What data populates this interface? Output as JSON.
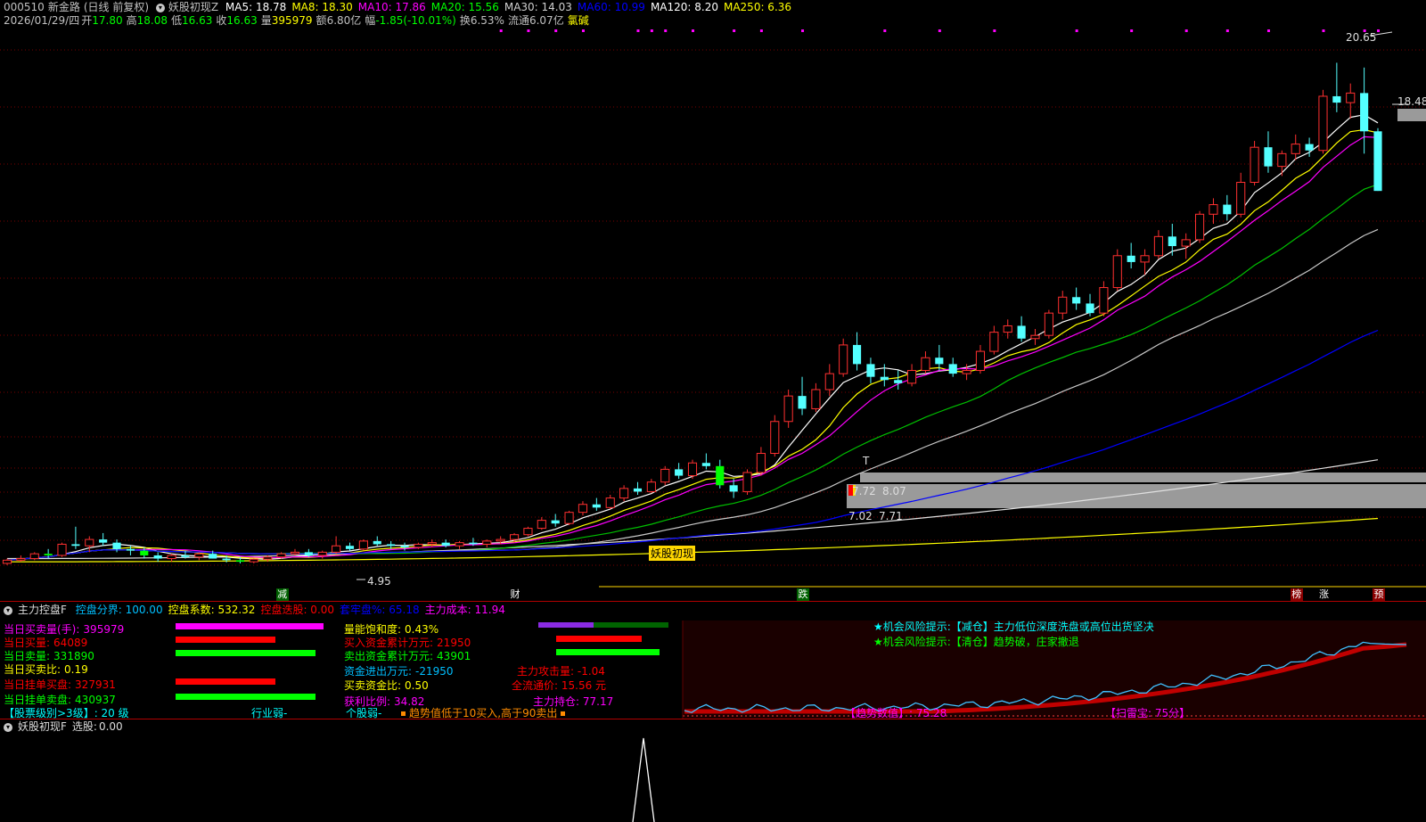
{
  "header": {
    "code": "000510",
    "name": "新金路",
    "period": "(日线 前复权)",
    "indicator": "妖股初现Z",
    "ma": [
      {
        "label": "MA5:",
        "value": "18.78",
        "color": "#ffffff"
      },
      {
        "label": "MA8:",
        "value": "18.30",
        "color": "#ffff00"
      },
      {
        "label": "MA10:",
        "value": "17.86",
        "color": "#ff00ff"
      },
      {
        "label": "MA20:",
        "value": "15.56",
        "color": "#00ff00"
      },
      {
        "label": "MA30:",
        "value": "14.03",
        "color": "#d0d0d0"
      },
      {
        "label": "MA60:",
        "value": "10.99",
        "color": "#0000ff"
      },
      {
        "label": "MA120:",
        "value": "8.20",
        "color": "#ffffff"
      },
      {
        "label": "MA250:",
        "value": "6.36",
        "color": "#ffff00"
      }
    ]
  },
  "quote": {
    "date": "2026/01/29/四",
    "open_label": "开",
    "open": "17.80",
    "high_label": "高",
    "high": "18.08",
    "low_label": "低",
    "low": "16.63",
    "close_label": "收",
    "close": "16.63",
    "vol_label": "量",
    "vol": "395979",
    "amt_label": "额",
    "amt": "6.80亿",
    "chg_label": "幅",
    "chg": "-1.85(-10.01%)",
    "turn_label": "换",
    "turn": "6.53%",
    "float_label": "流通",
    "float": "6.07亿",
    "sector": "氯碱"
  },
  "chart_data": {
    "type": "candlestick",
    "title": "",
    "price_labels": {
      "high": "20.65",
      "right": "18.48",
      "low": "4.95",
      "support_low": "7.02",
      "support_mid": "7.71",
      "zone_low": "7.72",
      "zone_high": "8.07",
      "mark_t": "T"
    },
    "signal_label": "妖股初现",
    "events": [
      {
        "label": "减",
        "color": "#ffffff",
        "bg": "#006000",
        "idx": 20
      },
      {
        "label": "财",
        "color": "#ffffff",
        "bg": "#000000",
        "idx": 37
      },
      {
        "label": "跌",
        "color": "#ffffff",
        "bg": "#006000",
        "idx": 58
      },
      {
        "label": "榜",
        "color": "#ffffff",
        "bg": "#8b0000",
        "idx": 94
      },
      {
        "label": "涨",
        "color": "#ffffff",
        "bg": "#000000",
        "idx": 96
      },
      {
        "label": "预",
        "color": "#ffffff",
        "bg": "#8b0000",
        "idx": 100
      }
    ],
    "ohlc": [
      [
        4.95,
        5.1,
        4.9,
        5.05
      ],
      [
        5.05,
        5.2,
        5.0,
        5.1
      ],
      [
        5.1,
        5.3,
        5.05,
        5.25
      ],
      [
        5.25,
        5.4,
        5.1,
        5.2
      ],
      [
        5.2,
        5.6,
        5.15,
        5.55
      ],
      [
        5.55,
        6.1,
        5.4,
        5.5
      ],
      [
        5.5,
        5.8,
        5.3,
        5.7
      ],
      [
        5.7,
        5.9,
        5.5,
        5.6
      ],
      [
        5.6,
        5.7,
        5.3,
        5.4
      ],
      [
        5.4,
        5.5,
        5.2,
        5.35
      ],
      [
        5.35,
        5.45,
        5.1,
        5.2
      ],
      [
        5.2,
        5.3,
        5.0,
        5.1
      ],
      [
        5.1,
        5.25,
        5.0,
        5.2
      ],
      [
        5.2,
        5.35,
        5.1,
        5.15
      ],
      [
        5.15,
        5.3,
        5.05,
        5.25
      ],
      [
        5.25,
        5.35,
        5.1,
        5.1
      ],
      [
        5.1,
        5.2,
        4.98,
        5.05
      ],
      [
        5.05,
        5.15,
        4.95,
        5.0
      ],
      [
        5.0,
        5.1,
        4.95,
        5.08
      ],
      [
        5.08,
        5.2,
        5.0,
        5.15
      ],
      [
        5.15,
        5.3,
        5.1,
        5.25
      ],
      [
        5.25,
        5.4,
        5.2,
        5.3
      ],
      [
        5.3,
        5.4,
        5.15,
        5.2
      ],
      [
        5.2,
        5.35,
        5.1,
        5.3
      ],
      [
        5.3,
        5.8,
        5.25,
        5.5
      ],
      [
        5.5,
        5.6,
        5.35,
        5.4
      ],
      [
        5.4,
        5.7,
        5.35,
        5.65
      ],
      [
        5.65,
        5.8,
        5.5,
        5.55
      ],
      [
        5.55,
        5.65,
        5.4,
        5.5
      ],
      [
        5.5,
        5.6,
        5.35,
        5.45
      ],
      [
        5.45,
        5.6,
        5.4,
        5.55
      ],
      [
        5.55,
        5.7,
        5.45,
        5.6
      ],
      [
        5.6,
        5.7,
        5.45,
        5.5
      ],
      [
        5.5,
        5.65,
        5.4,
        5.6
      ],
      [
        5.6,
        5.75,
        5.5,
        5.55
      ],
      [
        5.55,
        5.7,
        5.45,
        5.65
      ],
      [
        5.65,
        5.8,
        5.55,
        5.7
      ],
      [
        5.7,
        5.9,
        5.6,
        5.85
      ],
      [
        5.85,
        6.1,
        5.8,
        6.05
      ],
      [
        6.05,
        6.4,
        6.0,
        6.3
      ],
      [
        6.3,
        6.5,
        6.1,
        6.2
      ],
      [
        6.2,
        6.6,
        6.15,
        6.55
      ],
      [
        6.55,
        6.9,
        6.45,
        6.8
      ],
      [
        6.8,
        7.0,
        6.6,
        6.7
      ],
      [
        6.7,
        7.1,
        6.65,
        7.0
      ],
      [
        7.0,
        7.4,
        6.9,
        7.3
      ],
      [
        7.3,
        7.5,
        7.1,
        7.2
      ],
      [
        7.2,
        7.6,
        7.15,
        7.5
      ],
      [
        7.5,
        8.0,
        7.4,
        7.9
      ],
      [
        7.9,
        8.1,
        7.6,
        7.7
      ],
      [
        7.7,
        8.2,
        7.6,
        8.1
      ],
      [
        8.1,
        8.4,
        7.9,
        8.0
      ],
      [
        8.0,
        8.2,
        7.3,
        7.4
      ],
      [
        7.4,
        7.6,
        7.0,
        7.2
      ],
      [
        7.2,
        7.9,
        7.1,
        7.8
      ],
      [
        7.8,
        8.6,
        7.7,
        8.4
      ],
      [
        8.4,
        9.6,
        8.3,
        9.4
      ],
      [
        9.4,
        10.4,
        9.2,
        10.2
      ],
      [
        10.2,
        10.8,
        9.6,
        9.8
      ],
      [
        9.8,
        10.6,
        9.7,
        10.4
      ],
      [
        10.4,
        11.2,
        10.2,
        10.9
      ],
      [
        10.9,
        12.0,
        10.8,
        11.8
      ],
      [
        11.8,
        12.2,
        11.0,
        11.2
      ],
      [
        11.2,
        11.4,
        10.6,
        10.8
      ],
      [
        10.8,
        11.2,
        10.5,
        10.7
      ],
      [
        10.7,
        11.0,
        10.4,
        10.6
      ],
      [
        10.6,
        11.2,
        10.5,
        11.0
      ],
      [
        11.0,
        11.6,
        10.9,
        11.4
      ],
      [
        11.4,
        11.8,
        11.0,
        11.2
      ],
      [
        11.2,
        11.4,
        10.8,
        10.9
      ],
      [
        10.9,
        11.2,
        10.7,
        11.0
      ],
      [
        11.0,
        11.8,
        10.9,
        11.6
      ],
      [
        11.6,
        12.4,
        11.5,
        12.2
      ],
      [
        12.2,
        12.6,
        12.0,
        12.4
      ],
      [
        12.4,
        12.7,
        11.9,
        12.0
      ],
      [
        12.0,
        12.3,
        11.8,
        12.1
      ],
      [
        12.1,
        12.9,
        12.0,
        12.8
      ],
      [
        12.8,
        13.5,
        12.6,
        13.3
      ],
      [
        13.3,
        13.6,
        12.9,
        13.1
      ],
      [
        13.1,
        13.4,
        12.7,
        12.8
      ],
      [
        12.8,
        13.8,
        12.7,
        13.6
      ],
      [
        13.6,
        14.8,
        13.5,
        14.6
      ],
      [
        14.6,
        15.0,
        14.2,
        14.4
      ],
      [
        14.4,
        14.8,
        14.0,
        14.6
      ],
      [
        14.6,
        15.4,
        14.5,
        15.2
      ],
      [
        15.2,
        15.6,
        14.6,
        14.9
      ],
      [
        14.9,
        15.3,
        14.5,
        15.1
      ],
      [
        15.1,
        16.0,
        15.0,
        15.9
      ],
      [
        15.9,
        16.4,
        15.6,
        16.2
      ],
      [
        16.2,
        16.5,
        15.7,
        15.9
      ],
      [
        15.9,
        17.2,
        15.8,
        16.9
      ],
      [
        16.9,
        18.2,
        16.8,
        18.0
      ],
      [
        18.0,
        18.5,
        17.2,
        17.4
      ],
      [
        17.4,
        17.9,
        17.1,
        17.8
      ],
      [
        17.8,
        18.4,
        17.6,
        18.1
      ],
      [
        18.1,
        18.3,
        17.7,
        17.9
      ],
      [
        17.9,
        19.8,
        17.8,
        19.6
      ],
      [
        19.6,
        20.65,
        19.1,
        19.4
      ],
      [
        19.4,
        20.0,
        18.9,
        19.7
      ],
      [
        19.7,
        20.5,
        17.8,
        18.5
      ],
      [
        18.5,
        18.6,
        16.63,
        16.63
      ]
    ],
    "ma_series": [
      {
        "name": "MA5",
        "color": "#ffffff",
        "period": 5
      },
      {
        "name": "MA8",
        "color": "#ffff00",
        "period": 8
      },
      {
        "name": "MA10",
        "color": "#ff00ff",
        "period": 10
      },
      {
        "name": "MA20",
        "color": "#00c000",
        "period": 20
      },
      {
        "name": "MA30",
        "color": "#c8c8c8",
        "period": 30
      },
      {
        "name": "MA60",
        "color": "#0000ff",
        "period": 60
      }
    ],
    "long_ma": [
      {
        "name": "MA120",
        "color": "#e0e0e0",
        "start": 5.1,
        "end": 8.2
      },
      {
        "name": "MA250",
        "color": "#ffff00",
        "start": 5.0,
        "end": 6.36
      }
    ],
    "ylim": [
      4.5,
      21.5
    ]
  },
  "panel2": {
    "name": "主力控盘F",
    "items": [
      {
        "label": "控盘分界:",
        "value": "100.00",
        "color": "#00bfff"
      },
      {
        "label": "控盘系数:",
        "value": "532.32",
        "color": "#ffff00"
      },
      {
        "label": "控盘迭股:",
        "value": "0.00",
        "color": "#ff0000"
      },
      {
        "label": "套牢盘%:",
        "value": "65.18",
        "color": "#0000ff"
      },
      {
        "label": "主力成本:",
        "value": "11.94",
        "color": "#ff00ff"
      }
    ],
    "left_rows": [
      {
        "label": "当日买卖量(手):",
        "value": "395979",
        "color": "#ff00ff",
        "bar": "#ff00ff",
        "bw": 166
      },
      {
        "label": "当日买量:",
        "value": "64089",
        "color": "#ff0000",
        "bar": "#ff0000",
        "bw": 112
      },
      {
        "label": "当日卖量:",
        "value": "331890",
        "color": "#00ff00",
        "bar": "#00ff00",
        "bw": 157
      },
      {
        "label": "当日买卖比:",
        "value": "0.19",
        "color": "#ffff00",
        "bar": "",
        "bw": 0
      },
      {
        "label": "当日挂单买盘:",
        "value": "327931",
        "color": "#ff0000",
        "bar": "#ff0000",
        "bw": 112
      },
      {
        "label": "当日挂单卖盘:",
        "value": "430937",
        "color": "#00ff00",
        "bar": "#00ff00",
        "bw": 157
      }
    ],
    "level_row": {
      "text": "【股票级别>3级】: 20 级",
      "sector": "行业弱-",
      "stock": "个股弱-",
      "trend": "趋势值低于10买入,高于90卖出"
    },
    "mid_rows": [
      {
        "label": "量能饱和度:",
        "value": "0.43%",
        "color": "#ffff00"
      },
      {
        "label": "买入资金累计万元:",
        "value": "21950",
        "color": "#ff0000"
      },
      {
        "label": "卖出资金累计万元:",
        "value": "43901",
        "color": "#00ff00"
      },
      {
        "label": "资金进出万元:",
        "value": "-21950",
        "color": "#00bfff"
      },
      {
        "label": "买卖资金比:",
        "value": "0.50",
        "color": "#ffff00"
      },
      {
        "label": "获利比例:",
        "value": "34.82",
        "color": "#ff00ff"
      }
    ],
    "mid_right": [
      {
        "label": "主力攻击量:",
        "value": "-1.04",
        "color": "#ff0000"
      },
      {
        "label": "全流通价:",
        "value": "15.56 元",
        "color": "#ff0000"
      },
      {
        "label": "主力持仓:",
        "value": "77.17",
        "color": "#ff00ff"
      }
    ],
    "tips": [
      {
        "text": "★机会风险提示:【减仓】主力低位深度洗盘或高位出货坚决",
        "color": "#00ffff"
      },
      {
        "text": "★机会风险提示:【清仓】趋势破，庄家撤退",
        "color": "#00ff00"
      }
    ],
    "trend_label": "【趋势数值】: 75.28",
    "scan_label": "【扫雷宝: 75分】"
  },
  "panel3": {
    "name": "妖股初现F",
    "item_label": "选股:",
    "item_value": "0.00"
  }
}
